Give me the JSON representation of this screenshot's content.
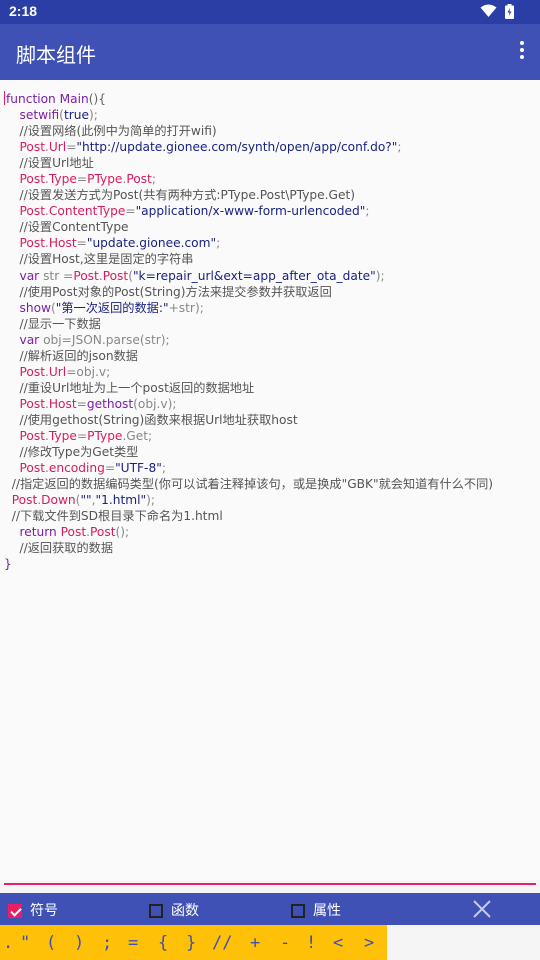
{
  "status_bar": {
    "time": "2:18"
  },
  "app_bar": {
    "title": "脚本组件"
  },
  "code_lines": [
    [
      [
        "t-kw",
        "function Main"
      ],
      [
        "t-dec",
        "(){"
      ]
    ],
    [
      [
        "",
        "    "
      ],
      [
        "t-kw",
        "setwifi"
      ],
      [
        "t-def",
        "("
      ],
      [
        "t-str",
        "true"
      ],
      [
        "t-def",
        ");"
      ]
    ],
    [
      [
        "",
        "    "
      ],
      [
        "t-com",
        "//设置网络(此例中为简单的打开wifi)"
      ]
    ],
    [
      [
        "",
        "    "
      ],
      [
        "t-mag",
        "Post"
      ],
      [
        "t-def",
        "."
      ],
      [
        "t-mag",
        "Url"
      ],
      [
        "t-def",
        "="
      ],
      [
        "t-str",
        "\"http://update.gionee.com/synth/open/app/conf.do?\""
      ],
      [
        "t-def",
        ";"
      ]
    ],
    [
      [
        "",
        "    "
      ],
      [
        "t-com",
        "//设置Url地址"
      ]
    ],
    [
      [
        "",
        "    "
      ],
      [
        "t-mag",
        "Post"
      ],
      [
        "t-def",
        "."
      ],
      [
        "t-mag",
        "Type"
      ],
      [
        "t-def",
        "="
      ],
      [
        "t-mag",
        "PType"
      ],
      [
        "t-def",
        "."
      ],
      [
        "t-mag",
        "Post"
      ],
      [
        "t-def",
        ";"
      ]
    ],
    [
      [
        "",
        "    "
      ],
      [
        "t-com",
        "//设置发送方式为Post(共有两种方式:PType.Post\\PType.Get)"
      ]
    ],
    [
      [
        "",
        "    "
      ],
      [
        "t-mag",
        "Post"
      ],
      [
        "t-def",
        "."
      ],
      [
        "t-mag",
        "ContentType"
      ],
      [
        "t-def",
        "="
      ],
      [
        "t-str",
        "\"application/x-www-form-urlencoded\""
      ],
      [
        "t-def",
        ";"
      ]
    ],
    [
      [
        "",
        "    "
      ],
      [
        "t-com",
        "//设置ContentType"
      ]
    ],
    [
      [
        "",
        "    "
      ],
      [
        "t-mag",
        "Post"
      ],
      [
        "t-def",
        "."
      ],
      [
        "t-mag",
        "Host"
      ],
      [
        "t-def",
        "="
      ],
      [
        "t-str",
        "\"update.gionee.com\""
      ],
      [
        "t-def",
        ";"
      ]
    ],
    [
      [
        "",
        "    "
      ],
      [
        "t-com",
        "//设置Host,这里是固定的字符串"
      ]
    ],
    [
      [
        "",
        "    "
      ],
      [
        "t-kw",
        "var"
      ],
      [
        "t-def",
        " str ="
      ],
      [
        "t-mag",
        "Post"
      ],
      [
        "t-def",
        "."
      ],
      [
        "t-mag",
        "Post"
      ],
      [
        "t-def",
        "("
      ],
      [
        "t-str",
        "\"k=repair_url&ext=app_after_ota_date\""
      ],
      [
        "t-def",
        ");"
      ]
    ],
    [
      [
        "",
        "    "
      ],
      [
        "t-com",
        "//使用Post对象的Post(String)方法来提交参数并获取返回"
      ]
    ],
    [
      [
        "",
        "    "
      ],
      [
        "t-kw",
        "show"
      ],
      [
        "t-def",
        "("
      ],
      [
        "t-str",
        "\"第一次返回的数据:\""
      ],
      [
        "t-def",
        "+str);"
      ]
    ],
    [
      [
        "",
        "    "
      ],
      [
        "t-com",
        "//显示一下数据"
      ]
    ],
    [
      [
        "",
        "    "
      ],
      [
        "t-kw",
        "var"
      ],
      [
        "t-def",
        " obj=JSON.parse(str);"
      ]
    ],
    [
      [
        "",
        "    "
      ],
      [
        "t-com",
        "//解析返回的json数据"
      ]
    ],
    [
      [
        "",
        "    "
      ],
      [
        "t-mag",
        "Post"
      ],
      [
        "t-def",
        "."
      ],
      [
        "t-mag",
        "Url"
      ],
      [
        "t-def",
        "=obj.v;"
      ]
    ],
    [
      [
        "",
        "    "
      ],
      [
        "t-com",
        "//重设Url地址为上一个post返回的数据地址"
      ]
    ],
    [
      [
        "",
        "    "
      ],
      [
        "t-mag",
        "Post"
      ],
      [
        "t-def",
        "."
      ],
      [
        "t-mag",
        "Host"
      ],
      [
        "t-def",
        "="
      ],
      [
        "t-kw",
        "gethost"
      ],
      [
        "t-def",
        "(obj.v);"
      ]
    ],
    [
      [
        "",
        "    "
      ],
      [
        "t-com",
        "//使用gethost(String)函数来根据Url地址获取host"
      ]
    ],
    [
      [
        "",
        "    "
      ],
      [
        "t-mag",
        "Post"
      ],
      [
        "t-def",
        "."
      ],
      [
        "t-mag",
        "Type"
      ],
      [
        "t-def",
        "="
      ],
      [
        "t-mag",
        "PType"
      ],
      [
        "t-def",
        ".Get;"
      ]
    ],
    [
      [
        "",
        "    "
      ],
      [
        "t-com",
        "//修改Type为Get类型"
      ]
    ],
    [
      [
        "",
        "    "
      ],
      [
        "t-mag",
        "Post"
      ],
      [
        "t-def",
        "."
      ],
      [
        "t-mag",
        "encoding"
      ],
      [
        "t-def",
        "="
      ],
      [
        "t-str",
        "\"UTF-8\""
      ],
      [
        "t-def",
        ";"
      ]
    ],
    [
      [
        "",
        "  "
      ],
      [
        "t-com",
        "//指定返回的数据编码类型(你可以试着注释掉该句，或是换成\"GBK\"就会知道有什么不同)"
      ]
    ],
    [
      [
        "",
        "  "
      ],
      [
        "t-mag",
        "Post"
      ],
      [
        "t-def",
        "."
      ],
      [
        "t-mag",
        "Down"
      ],
      [
        "t-def",
        "("
      ],
      [
        "t-str",
        "\"\""
      ],
      [
        "t-def",
        ","
      ],
      [
        "t-str",
        "\"1.html\""
      ],
      [
        "t-def",
        ");"
      ]
    ],
    [
      [
        "",
        "  "
      ],
      [
        "t-com",
        "//下载文件到SD根目录下命名为1.html"
      ]
    ],
    [
      [
        "",
        "    "
      ],
      [
        "t-kw",
        "return"
      ],
      [
        "t-def",
        " "
      ],
      [
        "t-mag",
        "Post"
      ],
      [
        "t-def",
        "."
      ],
      [
        "t-mag",
        "Post"
      ],
      [
        "t-def",
        "();"
      ]
    ],
    [
      [
        "",
        "    "
      ],
      [
        "t-com",
        "//返回获取的数据"
      ]
    ],
    [
      [
        "t-kw",
        "}"
      ]
    ]
  ],
  "options": [
    {
      "label": "符号",
      "checked": true
    },
    {
      "label": "函数",
      "checked": false
    },
    {
      "label": "属性",
      "checked": false
    }
  ],
  "symbols": [
    ".",
    "\"",
    "(",
    ")",
    ";",
    "=",
    "{",
    "}",
    "//",
    "+",
    "-",
    "!",
    "<",
    ">"
  ],
  "colors": {
    "status_bar": "#2b3ea6",
    "app_bar": "#3f51b5",
    "accent": "#e91e63",
    "symbol_bar": "#ffc107"
  }
}
